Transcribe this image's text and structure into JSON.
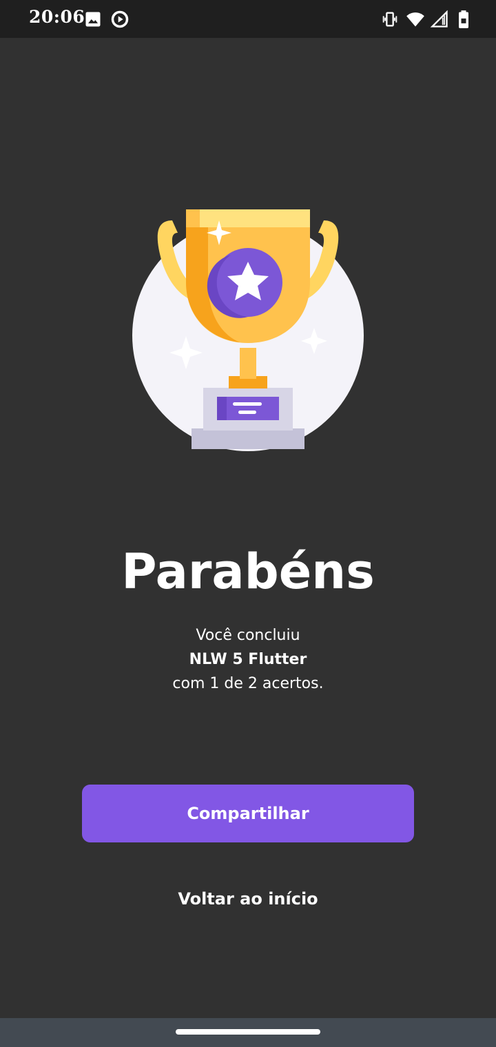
{
  "status_bar": {
    "time": "20:06",
    "icons": [
      "image-icon",
      "play-circle-icon",
      "vibrate-icon",
      "wifi-icon",
      "cellular-signal-icon",
      "battery-icon"
    ]
  },
  "result": {
    "title": "Parabéns",
    "line1": "Você concluiu",
    "quiz_name": "NLW 5 Flutter",
    "line3": "com 1 de 2 acertos."
  },
  "actions": {
    "share_label": "Compartilhar",
    "back_label": "Voltar ao início"
  },
  "colors": {
    "background": "#313131",
    "accent": "#8257e5",
    "trophy_gold": "#ffc24d",
    "trophy_star_bg": "#7c57d6"
  }
}
